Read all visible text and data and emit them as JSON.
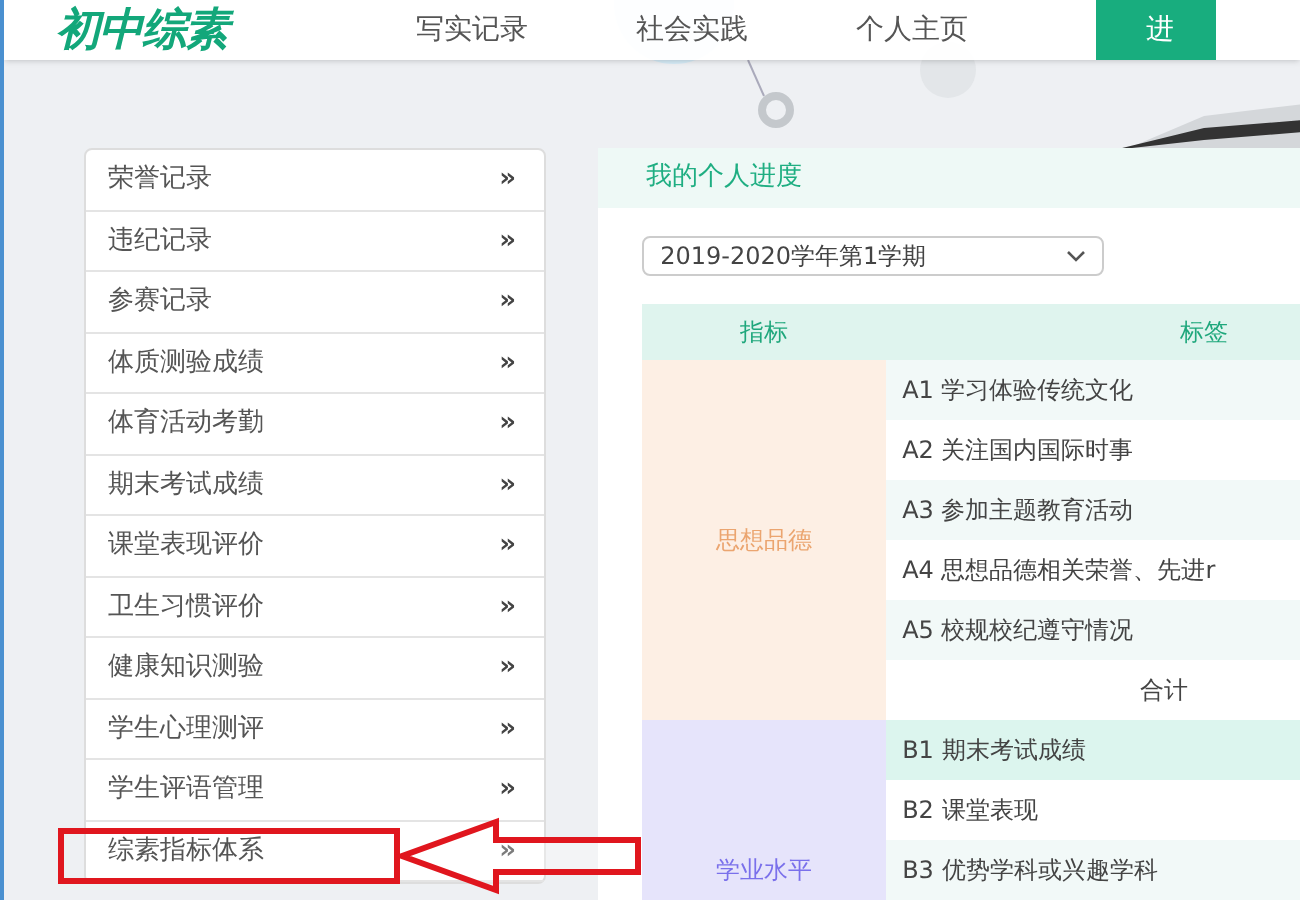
{
  "header": {
    "logo": "初中综素",
    "nav": [
      {
        "label": "写实记录",
        "selected": false
      },
      {
        "label": "社会实践",
        "selected": false
      },
      {
        "label": "个人主页",
        "selected": false
      },
      {
        "label": "进",
        "selected": true
      }
    ]
  },
  "sidebar": {
    "items": [
      {
        "label": "荣誉记录",
        "arrow": "»"
      },
      {
        "label": "违纪记录",
        "arrow": "»"
      },
      {
        "label": "参赛记录",
        "arrow": "»"
      },
      {
        "label": "体质测验成绩",
        "arrow": "»"
      },
      {
        "label": "体育活动考勤",
        "arrow": "»"
      },
      {
        "label": "期末考试成绩",
        "arrow": "»"
      },
      {
        "label": "课堂表现评价",
        "arrow": "»"
      },
      {
        "label": "卫生习惯评价",
        "arrow": "»"
      },
      {
        "label": "健康知识测验",
        "arrow": "»"
      },
      {
        "label": "学生心理测评",
        "arrow": "»"
      },
      {
        "label": "学生评语管理",
        "arrow": "»"
      },
      {
        "label": "综素指标体系",
        "arrow": "»"
      }
    ]
  },
  "panel": {
    "title": "我的个人进度",
    "term_select": {
      "value": "2019-2020学年第1学期"
    },
    "table": {
      "columns": [
        "指标",
        "标签"
      ],
      "groups": [
        {
          "indicator": "思想品德",
          "color": "#fdefe4",
          "rows": [
            {
              "label": "A1 学习体验传统文化",
              "selected": false
            },
            {
              "label": "A2 关注国内国际时事",
              "selected": false
            },
            {
              "label": "A3 参加主题教育活动",
              "selected": false
            },
            {
              "label": "A4 思想品德相关荣誉、先进r",
              "selected": false
            },
            {
              "label": "A5 校规校纪遵守情况",
              "selected": false
            }
          ],
          "total": "合计"
        },
        {
          "indicator": "学业水平",
          "color": "#e6e4fb",
          "rows": [
            {
              "label": "B1 期末考试成绩",
              "selected": true
            },
            {
              "label": "B2 课堂表现",
              "selected": false
            },
            {
              "label": "B3 优势学科或兴趣学科",
              "selected": false
            }
          ]
        }
      ]
    }
  }
}
